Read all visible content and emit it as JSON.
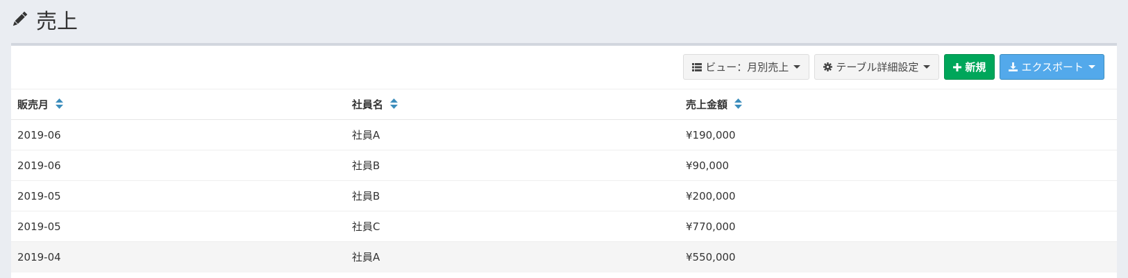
{
  "page": {
    "title": "売上"
  },
  "toolbar": {
    "view_label": "ビュー：月別売上",
    "table_settings_label": "テーブル詳細設定",
    "new_label": "新規",
    "export_label": "エクスポート"
  },
  "table": {
    "columns": [
      "販売月",
      "社員名",
      "売上金額"
    ],
    "rows": [
      [
        "2019-06",
        "社員A",
        "¥190,000"
      ],
      [
        "2019-06",
        "社員B",
        "¥90,000"
      ],
      [
        "2019-05",
        "社員B",
        "¥200,000"
      ],
      [
        "2019-05",
        "社員C",
        "¥770,000"
      ],
      [
        "2019-04",
        "社員A",
        "¥550,000"
      ]
    ]
  },
  "colors": {
    "success": "#00a65a",
    "primary": "#53a9eb",
    "sort_icon": "#3c8dbc"
  },
  "icons": {
    "title": "pencil-icon",
    "view": "list-icon",
    "settings": "gear-icon",
    "new": "plus-icon",
    "export": "download-icon",
    "sort": "sort-icon"
  }
}
